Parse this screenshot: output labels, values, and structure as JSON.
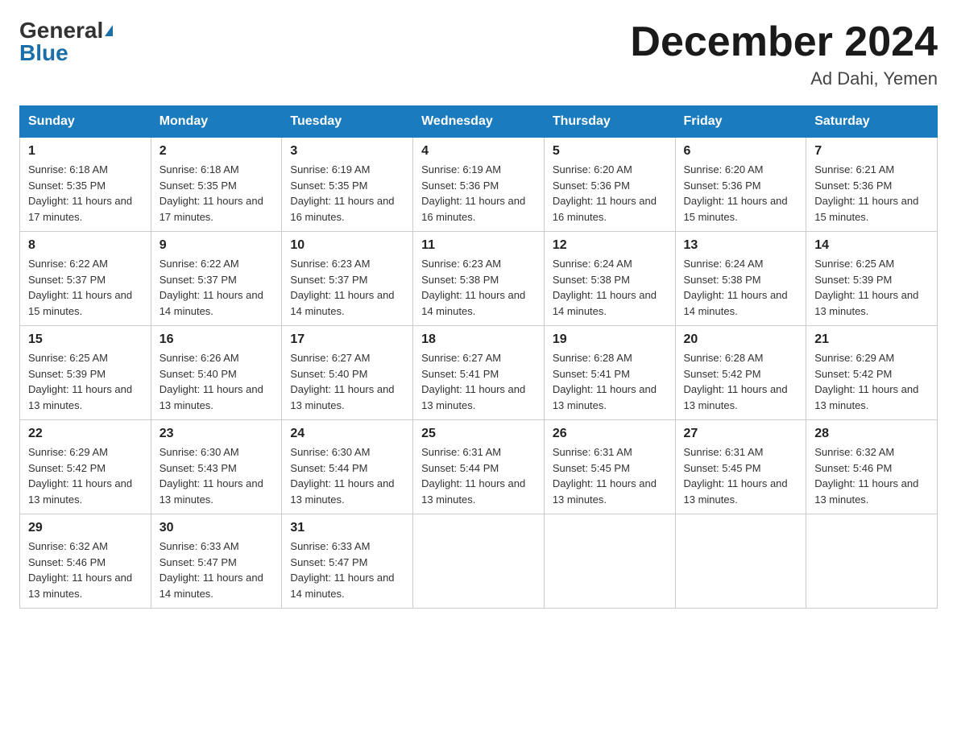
{
  "header": {
    "logo_general": "General",
    "logo_blue": "Blue",
    "month_title": "December 2024",
    "location": "Ad Dahi, Yemen"
  },
  "columns": [
    "Sunday",
    "Monday",
    "Tuesday",
    "Wednesday",
    "Thursday",
    "Friday",
    "Saturday"
  ],
  "weeks": [
    [
      {
        "day": "1",
        "sunrise": "6:18 AM",
        "sunset": "5:35 PM",
        "daylight": "11 hours and 17 minutes."
      },
      {
        "day": "2",
        "sunrise": "6:18 AM",
        "sunset": "5:35 PM",
        "daylight": "11 hours and 17 minutes."
      },
      {
        "day": "3",
        "sunrise": "6:19 AM",
        "sunset": "5:35 PM",
        "daylight": "11 hours and 16 minutes."
      },
      {
        "day": "4",
        "sunrise": "6:19 AM",
        "sunset": "5:36 PM",
        "daylight": "11 hours and 16 minutes."
      },
      {
        "day": "5",
        "sunrise": "6:20 AM",
        "sunset": "5:36 PM",
        "daylight": "11 hours and 16 minutes."
      },
      {
        "day": "6",
        "sunrise": "6:20 AM",
        "sunset": "5:36 PM",
        "daylight": "11 hours and 15 minutes."
      },
      {
        "day": "7",
        "sunrise": "6:21 AM",
        "sunset": "5:36 PM",
        "daylight": "11 hours and 15 minutes."
      }
    ],
    [
      {
        "day": "8",
        "sunrise": "6:22 AM",
        "sunset": "5:37 PM",
        "daylight": "11 hours and 15 minutes."
      },
      {
        "day": "9",
        "sunrise": "6:22 AM",
        "sunset": "5:37 PM",
        "daylight": "11 hours and 14 minutes."
      },
      {
        "day": "10",
        "sunrise": "6:23 AM",
        "sunset": "5:37 PM",
        "daylight": "11 hours and 14 minutes."
      },
      {
        "day": "11",
        "sunrise": "6:23 AM",
        "sunset": "5:38 PM",
        "daylight": "11 hours and 14 minutes."
      },
      {
        "day": "12",
        "sunrise": "6:24 AM",
        "sunset": "5:38 PM",
        "daylight": "11 hours and 14 minutes."
      },
      {
        "day": "13",
        "sunrise": "6:24 AM",
        "sunset": "5:38 PM",
        "daylight": "11 hours and 14 minutes."
      },
      {
        "day": "14",
        "sunrise": "6:25 AM",
        "sunset": "5:39 PM",
        "daylight": "11 hours and 13 minutes."
      }
    ],
    [
      {
        "day": "15",
        "sunrise": "6:25 AM",
        "sunset": "5:39 PM",
        "daylight": "11 hours and 13 minutes."
      },
      {
        "day": "16",
        "sunrise": "6:26 AM",
        "sunset": "5:40 PM",
        "daylight": "11 hours and 13 minutes."
      },
      {
        "day": "17",
        "sunrise": "6:27 AM",
        "sunset": "5:40 PM",
        "daylight": "11 hours and 13 minutes."
      },
      {
        "day": "18",
        "sunrise": "6:27 AM",
        "sunset": "5:41 PM",
        "daylight": "11 hours and 13 minutes."
      },
      {
        "day": "19",
        "sunrise": "6:28 AM",
        "sunset": "5:41 PM",
        "daylight": "11 hours and 13 minutes."
      },
      {
        "day": "20",
        "sunrise": "6:28 AM",
        "sunset": "5:42 PM",
        "daylight": "11 hours and 13 minutes."
      },
      {
        "day": "21",
        "sunrise": "6:29 AM",
        "sunset": "5:42 PM",
        "daylight": "11 hours and 13 minutes."
      }
    ],
    [
      {
        "day": "22",
        "sunrise": "6:29 AM",
        "sunset": "5:42 PM",
        "daylight": "11 hours and 13 minutes."
      },
      {
        "day": "23",
        "sunrise": "6:30 AM",
        "sunset": "5:43 PM",
        "daylight": "11 hours and 13 minutes."
      },
      {
        "day": "24",
        "sunrise": "6:30 AM",
        "sunset": "5:44 PM",
        "daylight": "11 hours and 13 minutes."
      },
      {
        "day": "25",
        "sunrise": "6:31 AM",
        "sunset": "5:44 PM",
        "daylight": "11 hours and 13 minutes."
      },
      {
        "day": "26",
        "sunrise": "6:31 AM",
        "sunset": "5:45 PM",
        "daylight": "11 hours and 13 minutes."
      },
      {
        "day": "27",
        "sunrise": "6:31 AM",
        "sunset": "5:45 PM",
        "daylight": "11 hours and 13 minutes."
      },
      {
        "day": "28",
        "sunrise": "6:32 AM",
        "sunset": "5:46 PM",
        "daylight": "11 hours and 13 minutes."
      }
    ],
    [
      {
        "day": "29",
        "sunrise": "6:32 AM",
        "sunset": "5:46 PM",
        "daylight": "11 hours and 13 minutes."
      },
      {
        "day": "30",
        "sunrise": "6:33 AM",
        "sunset": "5:47 PM",
        "daylight": "11 hours and 14 minutes."
      },
      {
        "day": "31",
        "sunrise": "6:33 AM",
        "sunset": "5:47 PM",
        "daylight": "11 hours and 14 minutes."
      },
      null,
      null,
      null,
      null
    ]
  ]
}
